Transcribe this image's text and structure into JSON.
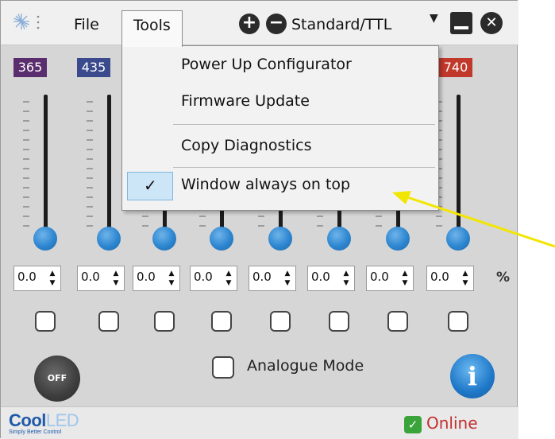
{
  "menu": {
    "file": "File",
    "tools": "Tools"
  },
  "mode": {
    "selected": "Standard/TTL"
  },
  "channels": [
    {
      "label": "365",
      "color": "#5a2d6e",
      "value": "0.0"
    },
    {
      "label": "435",
      "color": "#3b4a8c",
      "value": "0.0"
    },
    {
      "label": "",
      "color": "#000000",
      "value": "0.0"
    },
    {
      "label": "",
      "color": "#000000",
      "value": "0.0"
    },
    {
      "label": "",
      "color": "#000000",
      "value": "0.0"
    },
    {
      "label": "",
      "color": "#000000",
      "value": "0.0"
    },
    {
      "label": "",
      "color": "#000000",
      "value": "0.0"
    },
    {
      "label": "740",
      "color": "#c0392b",
      "value": "0.0"
    }
  ],
  "units": {
    "percent": "%"
  },
  "controls": {
    "off_label": "OFF",
    "analogue_mode": "Analogue Mode",
    "info_glyph": "i"
  },
  "status": {
    "brand": "CoolLED",
    "brand_tagline": "Simply Better Control",
    "online": "Online",
    "online_color": "#3aa33a"
  },
  "tools_menu": {
    "items": [
      {
        "label": "Power Up Configurator"
      },
      {
        "label": "Firmware Update"
      },
      {
        "label": "Copy Diagnostics"
      },
      {
        "label": "Window always on top",
        "checked": true
      }
    ]
  },
  "icons": {
    "logo": "coolled-burst-icon",
    "plus": "plus-circle-icon",
    "minus": "minus-circle-icon",
    "dropdown": "chevron-down-icon",
    "minimize": "minimize-icon",
    "close": "close-circle-icon",
    "online": "check-icon",
    "info": "info-icon",
    "power": "power-off-icon"
  },
  "annotation": {
    "arrow_color": "#f2e600"
  }
}
